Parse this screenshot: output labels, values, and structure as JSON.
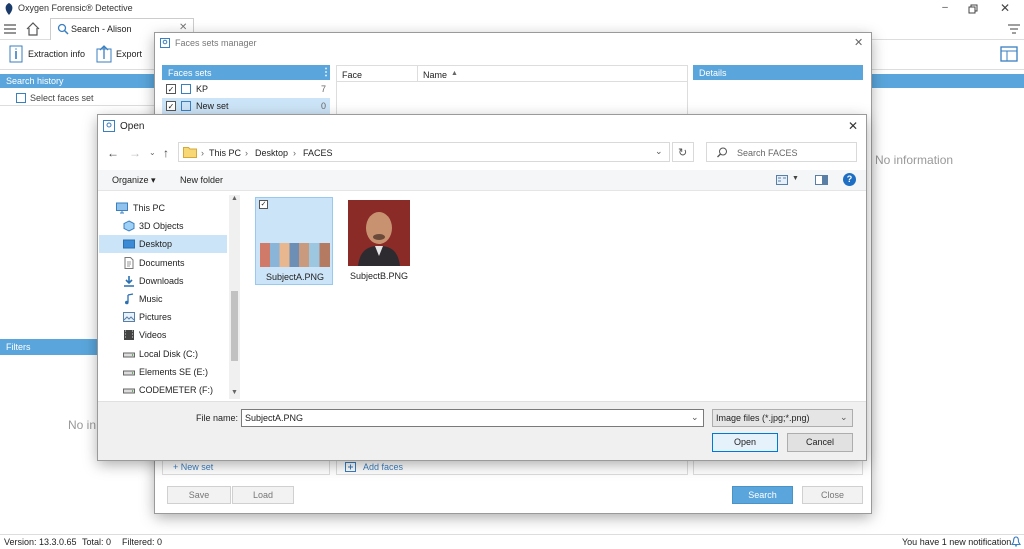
{
  "app": {
    "title": "Oxygen Forensic® Detective",
    "tab_label": "Search - Alison",
    "toolbar": {
      "extraction_info": "Extraction info",
      "export": "Export"
    },
    "left": {
      "search_history": "Search history",
      "select_faces_set": "Select faces set",
      "filters": "Filters",
      "no_info_clipped": "No in"
    },
    "right_no_info": "No information",
    "status": {
      "version": "Version: 13.3.0.65",
      "total": "Total: 0",
      "filtered": "Filtered: 0",
      "notification": "You have 1 new notification"
    },
    "colors": {
      "accent": "#5aa6dc",
      "window_bg": "#ffffff"
    }
  },
  "faces_manager": {
    "title": "Faces sets manager",
    "faces_sets_header": "Faces sets",
    "sets": [
      {
        "name": "KP",
        "count": "7",
        "checked": true
      },
      {
        "name": "New set",
        "count": "0",
        "checked": true
      }
    ],
    "columns": {
      "face": "Face",
      "name": "Name"
    },
    "details_header": "Details",
    "new_set": "+ New set",
    "add_faces": "Add faces",
    "save": "Save",
    "load": "Load",
    "search": "Search",
    "close": "Close"
  },
  "open_dialog": {
    "title": "Open",
    "breadcrumb": [
      "This PC",
      "Desktop",
      "FACES"
    ],
    "search_placeholder": "Search FACES",
    "organize": "Organize ▾",
    "new_folder": "New folder",
    "nav": [
      {
        "label": "This PC",
        "icon": "computer-icon",
        "level": 0
      },
      {
        "label": "3D Objects",
        "icon": "cube-icon",
        "level": 1
      },
      {
        "label": "Desktop",
        "icon": "desktop-icon",
        "level": 1,
        "selected": true
      },
      {
        "label": "Documents",
        "icon": "document-icon",
        "level": 1
      },
      {
        "label": "Downloads",
        "icon": "download-icon",
        "level": 1
      },
      {
        "label": "Music",
        "icon": "music-icon",
        "level": 1
      },
      {
        "label": "Pictures",
        "icon": "picture-icon",
        "level": 1
      },
      {
        "label": "Videos",
        "icon": "video-icon",
        "level": 1
      },
      {
        "label": "Local Disk (C:)",
        "icon": "drive-icon",
        "level": 1
      },
      {
        "label": "Elements SE (E:)",
        "icon": "drive-icon",
        "level": 1
      },
      {
        "label": "CODEMETER (F:)",
        "icon": "drive-icon",
        "level": 1
      }
    ],
    "files": [
      {
        "name": "SubjectA.PNG",
        "selected": true,
        "thumb": "collage-thumbnail"
      },
      {
        "name": "SubjectB.PNG",
        "selected": false,
        "thumb": "portrait-thumbnail"
      }
    ],
    "file_name_label": "File name:",
    "file_name_value": "SubjectA.PNG",
    "file_type": "Image files (*.jpg;*.png)",
    "open_btn": "Open",
    "cancel_btn": "Cancel"
  }
}
